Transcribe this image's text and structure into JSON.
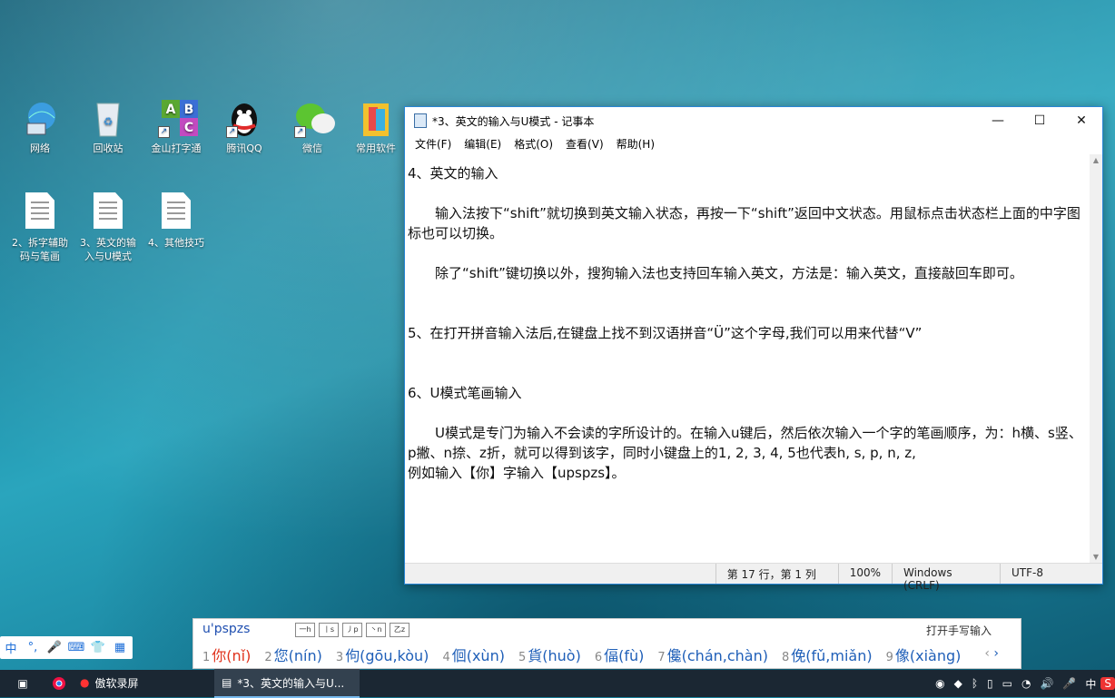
{
  "desktop": {
    "icons_row1": [
      {
        "label": "网络",
        "icon": "network-icon"
      },
      {
        "label": "回收站",
        "icon": "recycle-bin-icon"
      },
      {
        "label": "金山打字通",
        "icon": "typing-app-icon"
      },
      {
        "label": "腾讯QQ",
        "icon": "qq-icon"
      },
      {
        "label": "微信",
        "icon": "wechat-icon"
      },
      {
        "label": "常用软件",
        "icon": "folder-icon"
      }
    ],
    "icons_row2": [
      {
        "label": "2、拆字辅助码与笔画"
      },
      {
        "label": "3、英文的输入与U模式"
      },
      {
        "label": "4、其他技巧"
      }
    ]
  },
  "notepad": {
    "title": "*3、英文的输入与U模式 - 记事本",
    "menu": [
      "文件(F)",
      "编辑(E)",
      "格式(O)",
      "查看(V)",
      "帮助(H)"
    ],
    "lines": [
      "4、英文的输入",
      "",
      "　　输入法按下“shift”就切换到英文输入状态，再按一下“shift”返回中文状态。用鼠标点击状态栏上面的中字图标也可以切换。",
      "",
      "　　除了“shift”键切换以外，搜狗输入法也支持回车输入英文，方法是：输入英文，直接敲回车即可。",
      "",
      "",
      "5、在打开拼音输入法后,在键盘上找不到汉语拼音“Ü”这个字母,我们可以用来代替“V”",
      "",
      "",
      "6、U模式笔画输入",
      "",
      "　　U模式是专门为输入不会读的字所设计的。在输入u键后，然后依次输入一个字的笔画顺序，为：h横、s竖、p撇、n捺、z折，就可以得到该字，同时小键盘上的1, 2, 3, 4, 5也代表h, s, p, n, z,",
      "例如输入【你】字输入【upspzs】。",
      "",
      ""
    ],
    "status": {
      "position": "第 17 行，第 1 列",
      "zoom": "100%",
      "eol": "Windows (CRLF)",
      "encoding": "UTF-8"
    }
  },
  "ime_toolbar": [
    "中",
    "°,",
    "🎤",
    "⌨",
    "👕",
    "▦"
  ],
  "candidate": {
    "pinyin": "u'pspzs",
    "strokes": [
      "一h",
      "丨s",
      "丿p",
      "丶n",
      "乙z"
    ],
    "handwrite": "打开手写输入",
    "items": [
      {
        "n": "1",
        "text": "你(nǐ)"
      },
      {
        "n": "2",
        "text": "您(nín)"
      },
      {
        "n": "3",
        "text": "佝(gōu,kòu)"
      },
      {
        "n": "4",
        "text": "佪(xùn)"
      },
      {
        "n": "5",
        "text": "貨(huò)"
      },
      {
        "n": "6",
        "text": "偪(fù)"
      },
      {
        "n": "7",
        "text": "儳(chán,chàn)"
      },
      {
        "n": "8",
        "text": "俛(fǔ,miǎn)"
      },
      {
        "n": "9",
        "text": "像(xiàng)"
      }
    ]
  },
  "taskbar": {
    "apps": [
      {
        "label": "傲软录屏"
      },
      {
        "label": "*3、英文的输入与U..."
      }
    ],
    "tray_lang": "中"
  }
}
